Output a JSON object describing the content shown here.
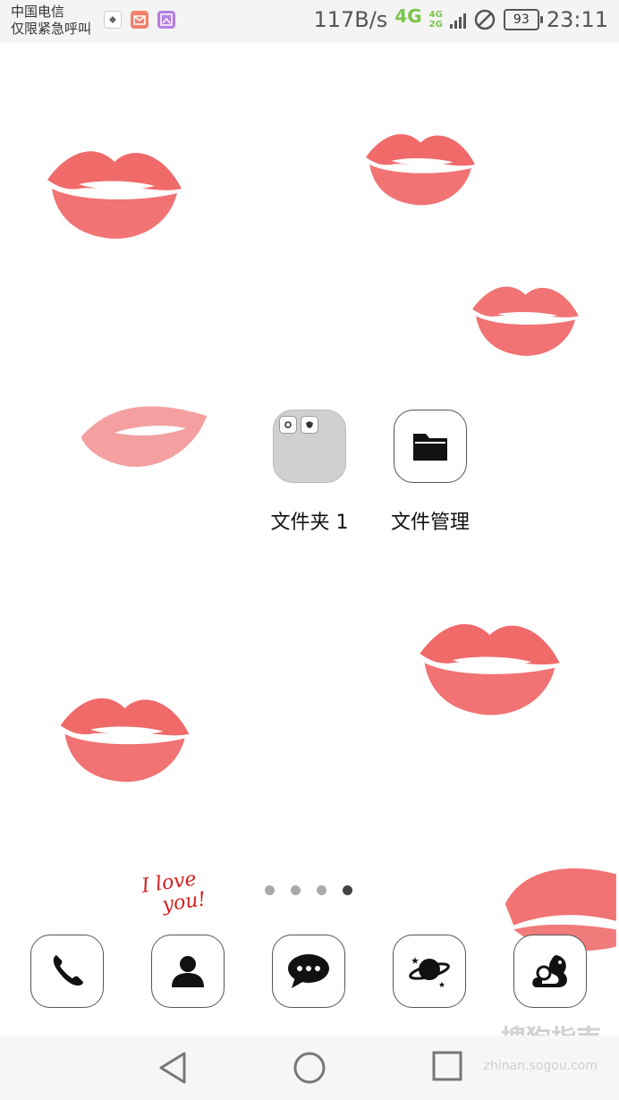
{
  "status_bar": {
    "carrier": "中国电信",
    "carrier_sub": "仅限紧急呼叫",
    "net_speed": "117B/s",
    "net_type": "4G",
    "net_stack_top": "4G",
    "net_stack_bottom": "2G",
    "battery": "93",
    "time": "23:11"
  },
  "wallpaper": {
    "love_text_line1": "I love",
    "love_text_line2": "you!"
  },
  "apps": [
    {
      "label": "文件夹 1",
      "icon": "folder-icon"
    },
    {
      "label": "文件管理",
      "icon": "file-manager-icon"
    }
  ],
  "page_indicator": {
    "count": 4,
    "active": 4
  },
  "dock": [
    {
      "icon": "phone-icon"
    },
    {
      "icon": "contacts-icon"
    },
    {
      "icon": "messages-icon"
    },
    {
      "icon": "browser-planet-icon"
    },
    {
      "icon": "uc-browser-icon"
    }
  ],
  "navbar": {
    "back": "back-icon",
    "home": "home-icon",
    "recent": "recents-icon"
  },
  "watermark": {
    "text": "搜狗指南",
    "sub": "zhinan.sogou.com"
  }
}
